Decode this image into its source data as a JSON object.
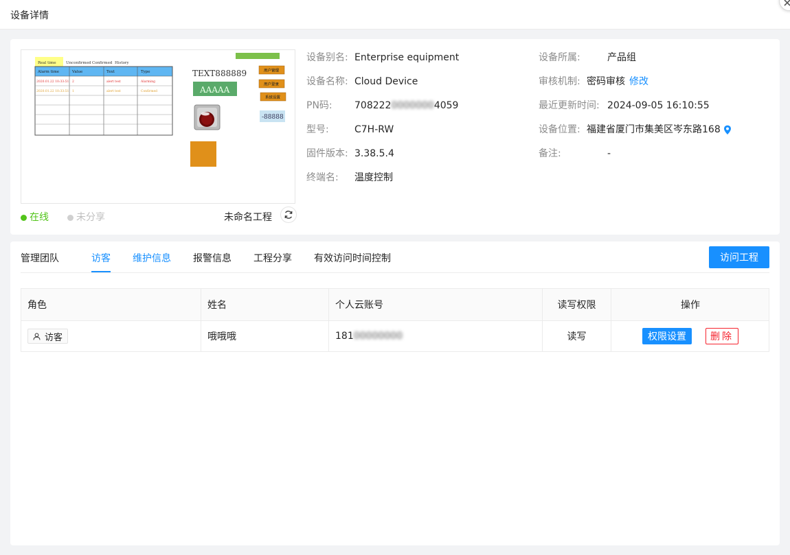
{
  "header": {
    "title": "设备详情"
  },
  "preview": {
    "table_tabs": [
      "Real time",
      "Unconfirmed",
      "Confirmed",
      "History"
    ],
    "table_headers": [
      "Alarm time",
      "Value",
      "Text",
      "Type"
    ],
    "table_rows": [
      [
        "2020.01.22 10:33:51",
        "2",
        "alert test",
        "Alarming"
      ],
      [
        "2020.01.22 10:33:51",
        "1",
        "alert test",
        "Confirmed"
      ]
    ],
    "text_label": "TEXT888889",
    "green_box_text": "AAAAA",
    "side_buttons": [
      "用户管理",
      "用户登录",
      "系统设置"
    ],
    "number_display": "-88888"
  },
  "status": {
    "online": "在线",
    "share": "未分享",
    "project": "未命名工程"
  },
  "info_left": [
    {
      "label": "设备别名:",
      "value": "Enterprise equipment"
    },
    {
      "label": "设备名称:",
      "value": "Cloud Device"
    },
    {
      "label": "PN码:",
      "value_prefix": "708222",
      "value_masked": "0000000",
      "value_suffix": "4059"
    },
    {
      "label": "型号:",
      "value": "C7H-RW"
    },
    {
      "label": "固件版本:",
      "value": "3.38.5.4"
    },
    {
      "label": "终端名:",
      "value": "温度控制"
    }
  ],
  "info_right": [
    {
      "label": "设备所属:",
      "value": "产品组"
    },
    {
      "label": "审核机制:",
      "value": "密码审核",
      "link": "修改"
    },
    {
      "label": "最近更新时间:",
      "value": "2024-09-05 16:10:55"
    },
    {
      "label": "设备位置:",
      "value": "福建省厦门市集美区岑东路168"
    },
    {
      "label": "备注:",
      "value": "-"
    }
  ],
  "tabs": [
    "管理团队",
    "访客",
    "维护信息",
    "报警信息",
    "工程分享",
    "有效访问时间控制"
  ],
  "visit_button": "访问工程",
  "table": {
    "headers": [
      "角色",
      "姓名",
      "个人云账号",
      "读写权限",
      "操作"
    ],
    "rows": [
      {
        "role": "访客",
        "name": "哦哦哦",
        "account_prefix": "181",
        "account_masked": "00000000",
        "permission": "读写",
        "perm_btn": "权限设置",
        "del_btn": "删除"
      }
    ]
  },
  "colors": {
    "primary": "#1890ff",
    "online": "#52c41a",
    "danger": "#f5222d"
  }
}
